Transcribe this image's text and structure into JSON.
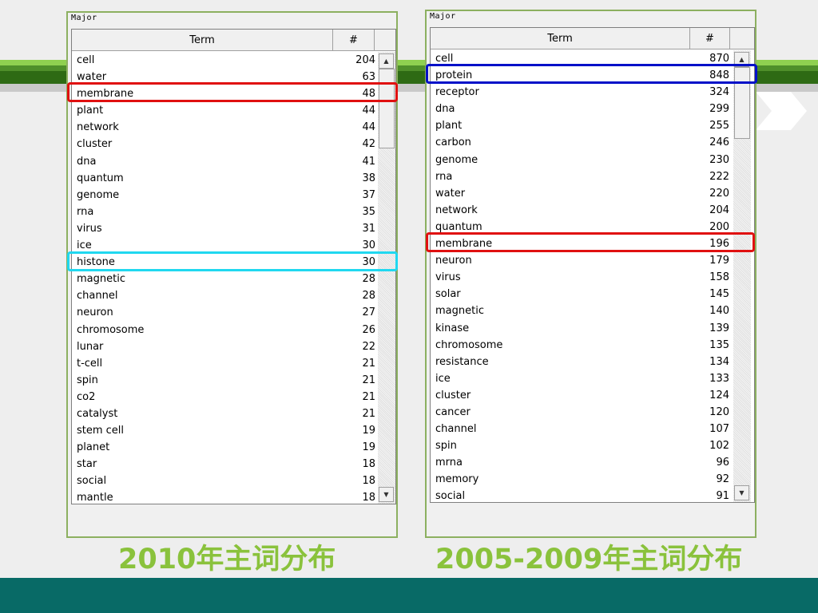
{
  "colors": {
    "accent_green": "#8ac23c",
    "footer_teal": "#086a66",
    "highlight_red": "#e01010",
    "highlight_cyan": "#20d8f0",
    "highlight_blue": "#0010c8"
  },
  "left_panel": {
    "group_title": "Major",
    "header_term": "Term",
    "header_count": "#",
    "caption": "2010年主词分布",
    "rows": [
      {
        "term": "cell",
        "count": "204"
      },
      {
        "term": "water",
        "count": "63"
      },
      {
        "term": "membrane",
        "count": "48"
      },
      {
        "term": "plant",
        "count": "44"
      },
      {
        "term": "network",
        "count": "44"
      },
      {
        "term": "cluster",
        "count": "42"
      },
      {
        "term": "dna",
        "count": "41"
      },
      {
        "term": "quantum",
        "count": "38"
      },
      {
        "term": "genome",
        "count": "37"
      },
      {
        "term": "rna",
        "count": "35"
      },
      {
        "term": "virus",
        "count": "31"
      },
      {
        "term": "ice",
        "count": "30"
      },
      {
        "term": "histone",
        "count": "30"
      },
      {
        "term": "magnetic",
        "count": "28"
      },
      {
        "term": "channel",
        "count": "28"
      },
      {
        "term": "neuron",
        "count": "27"
      },
      {
        "term": "chromosome",
        "count": "26"
      },
      {
        "term": "lunar",
        "count": "22"
      },
      {
        "term": "t-cell",
        "count": "21"
      },
      {
        "term": "spin",
        "count": "21"
      },
      {
        "term": "co2",
        "count": "21"
      },
      {
        "term": "catalyst",
        "count": "21"
      },
      {
        "term": "stem cell",
        "count": "19"
      },
      {
        "term": "planet",
        "count": "19"
      },
      {
        "term": "star",
        "count": "18"
      },
      {
        "term": "social",
        "count": "18"
      },
      {
        "term": "mantle",
        "count": "18"
      }
    ]
  },
  "right_panel": {
    "group_title": "Major",
    "header_term": "Term",
    "header_count": "#",
    "caption": "2005-2009年主词分布",
    "rows": [
      {
        "term": "cell",
        "count": "870"
      },
      {
        "term": "protein",
        "count": "848"
      },
      {
        "term": "receptor",
        "count": "324"
      },
      {
        "term": "dna",
        "count": "299"
      },
      {
        "term": "plant",
        "count": "255"
      },
      {
        "term": "carbon",
        "count": "246"
      },
      {
        "term": "genome",
        "count": "230"
      },
      {
        "term": "rna",
        "count": "222"
      },
      {
        "term": "water",
        "count": "220"
      },
      {
        "term": "network",
        "count": "204"
      },
      {
        "term": "quantum",
        "count": "200"
      },
      {
        "term": "membrane",
        "count": "196"
      },
      {
        "term": "neuron",
        "count": "179"
      },
      {
        "term": "virus",
        "count": "158"
      },
      {
        "term": "solar",
        "count": "145"
      },
      {
        "term": "magnetic",
        "count": "140"
      },
      {
        "term": "kinase",
        "count": "139"
      },
      {
        "term": "chromosome",
        "count": "135"
      },
      {
        "term": "resistance",
        "count": "134"
      },
      {
        "term": "ice",
        "count": "133"
      },
      {
        "term": "cluster",
        "count": "124"
      },
      {
        "term": "cancer",
        "count": "120"
      },
      {
        "term": "channel",
        "count": "107"
      },
      {
        "term": "spin",
        "count": "102"
      },
      {
        "term": "mrna",
        "count": "96"
      },
      {
        "term": "memory",
        "count": "92"
      },
      {
        "term": "social",
        "count": "91"
      }
    ]
  }
}
